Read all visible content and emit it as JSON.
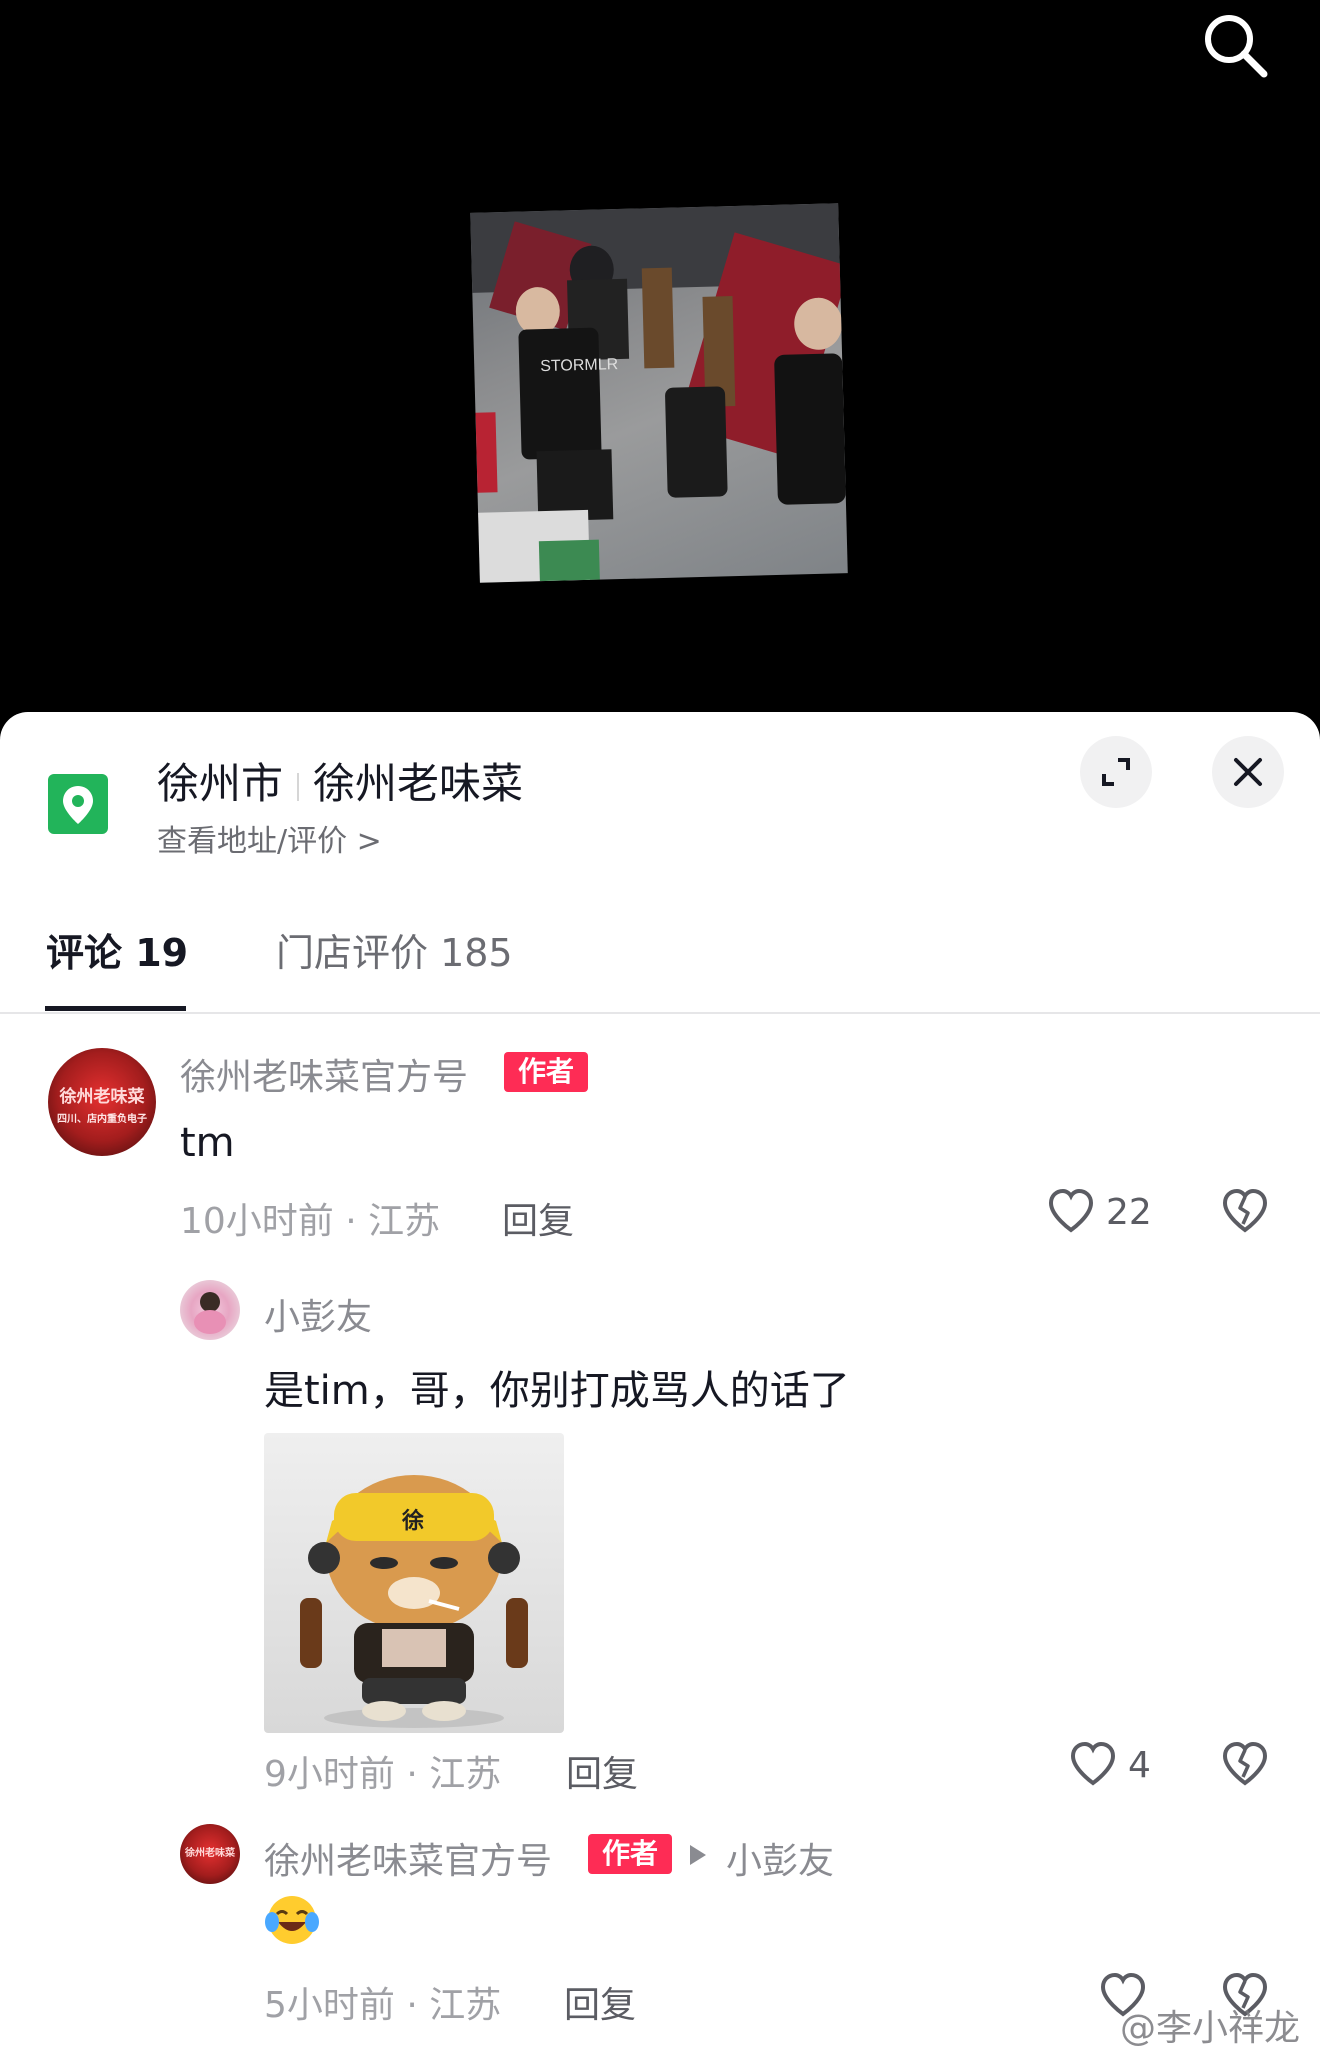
{
  "video": {
    "search_icon": "search-icon",
    "thumbnail_text": "STORMLR"
  },
  "location": {
    "icon": "map-pin-icon",
    "city": "徐州市",
    "shop": "徐州老味菜",
    "subtitle": "查看地址/评价 >",
    "expand_icon": "expand-icon",
    "close_icon": "close-icon",
    "brand_color": "#22b45a"
  },
  "tabs": [
    {
      "label": "评论 19",
      "active": true
    },
    {
      "label": "门店评价 185",
      "active": false
    }
  ],
  "comments": [
    {
      "avatar_text": "徐州老味菜",
      "avatar_sub": "四川、店内重负电子",
      "username": "徐州老味菜官方号",
      "badge": "作者",
      "text": "tm",
      "meta": "10小时前 · 江苏",
      "reply_label": "回复",
      "likes": "22"
    }
  ],
  "replies": [
    {
      "username": "小彭友",
      "text": "是tim，哥，你别打成骂人的话了",
      "sticker_text": "徐",
      "meta": "9小时前 · 江苏",
      "reply_label": "回复",
      "likes": "4"
    },
    {
      "avatar_text": "徐州老味菜",
      "username": "徐州老味菜官方号",
      "badge": "作者",
      "reply_to": "小彭友",
      "emoji": "laughing-crying-emoji",
      "meta": "5小时前 · 江苏",
      "reply_label": "回复",
      "likes": ""
    }
  ],
  "watermark": "@李小祥龙",
  "colors": {
    "badge": "#fe2c55",
    "text": "#161823",
    "secondary": "#8a8b91"
  }
}
